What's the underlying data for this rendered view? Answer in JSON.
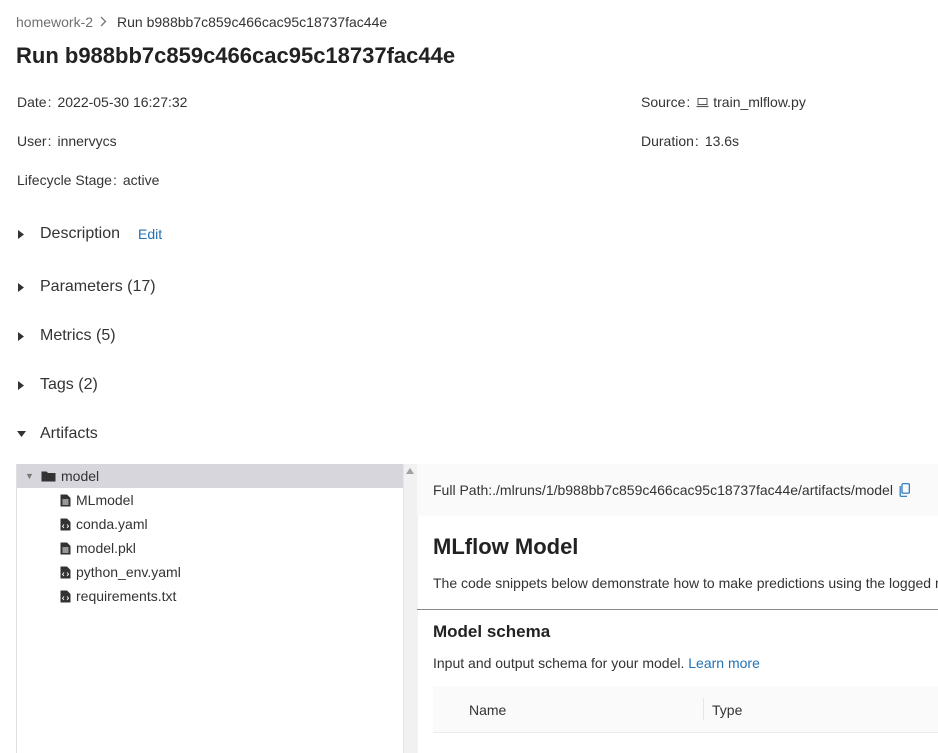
{
  "breadcrumb": {
    "experiment": "homework-2",
    "current": "Run b988bb7c859c466cac95c18737fac44e"
  },
  "title": "Run b988bb7c859c466cac95c18737fac44e",
  "metadata": {
    "date": {
      "label": "Date",
      "value": "2022-05-30 16:27:32"
    },
    "user": {
      "label": "User",
      "value": "innervycs"
    },
    "lifecycle": {
      "label": "Lifecycle Stage",
      "value": "active"
    },
    "source": {
      "label": "Source",
      "value": "train_mlflow.py"
    },
    "duration": {
      "label": "Duration",
      "value": "13.6s"
    }
  },
  "sections": {
    "description": {
      "label": "Description",
      "edit": "Edit"
    },
    "parameters": {
      "label": "Parameters (17)"
    },
    "metrics": {
      "label": "Metrics (5)"
    },
    "tags": {
      "label": "Tags (2)"
    },
    "artifacts": {
      "label": "Artifacts"
    }
  },
  "artifacts": {
    "tree": [
      {
        "name": "model",
        "type": "folder",
        "expanded": true,
        "selected": true
      },
      {
        "name": "MLmodel",
        "type": "file"
      },
      {
        "name": "conda.yaml",
        "type": "code-file"
      },
      {
        "name": "model.pkl",
        "type": "file"
      },
      {
        "name": "python_env.yaml",
        "type": "code-file"
      },
      {
        "name": "requirements.txt",
        "type": "code-file"
      }
    ],
    "full_path": "Full Path:./mlruns/1/b988bb7c859c466cac95c18737fac44e/artifacts/model",
    "model_heading": "MLflow Model",
    "model_description": "The code snippets below demonstrate how to make predictions using the logged model.",
    "schema_heading": "Model schema",
    "schema_description": "Input and output schema for your model.",
    "learn_more": "Learn more",
    "schema_columns": [
      "Name",
      "Type"
    ]
  },
  "colors": {
    "link": "#2272b4",
    "selected_row": "#d6d6dc"
  }
}
